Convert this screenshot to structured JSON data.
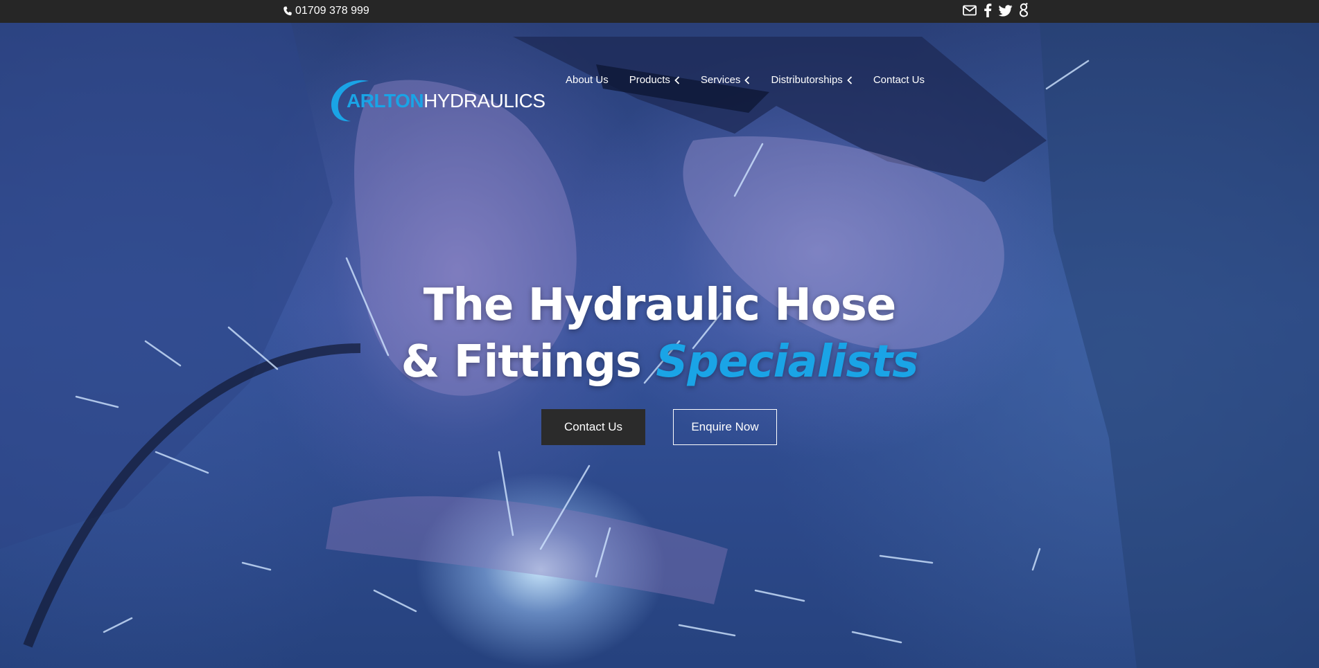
{
  "topbar": {
    "phone": "01709 378 999",
    "phone_icon": "phone-icon",
    "socials": [
      {
        "name": "email",
        "icon": "envelope-icon"
      },
      {
        "name": "facebook",
        "icon": "facebook-icon"
      },
      {
        "name": "twitter",
        "icon": "twitter-icon"
      },
      {
        "name": "google-plus",
        "icon": "google-plus-icon"
      }
    ]
  },
  "header": {
    "logo": {
      "word_a": "ARLTON",
      "word_b": "HYDRAULICS",
      "initial": "C"
    },
    "nav": [
      {
        "label": "About Us",
        "has_dropdown": false
      },
      {
        "label": "Products",
        "has_dropdown": true
      },
      {
        "label": "Services",
        "has_dropdown": true
      },
      {
        "label": "Distributorships",
        "has_dropdown": true
      },
      {
        "label": "Contact Us",
        "has_dropdown": false
      }
    ]
  },
  "hero": {
    "line1": "The Hydraulic Hose",
    "line2_a": "& Fittings",
    "line2_b": "Specialists",
    "primary_button": "Contact Us",
    "secondary_button": "Enquire Now"
  },
  "colors": {
    "accent": "#1aa4e6",
    "topbar": "#262626",
    "button_dark": "#2b2b2b"
  }
}
